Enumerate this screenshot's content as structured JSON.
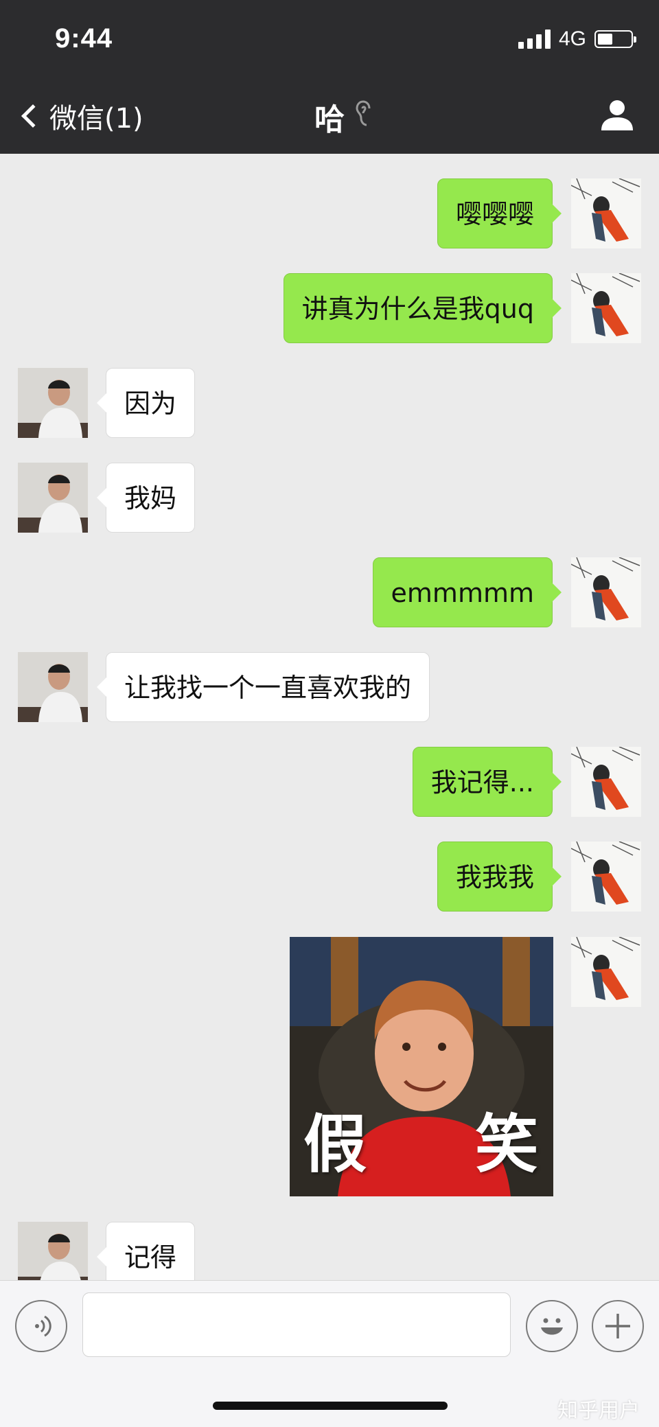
{
  "status_bar": {
    "time": "9:44",
    "network": "4G"
  },
  "nav": {
    "back_label": "微信(1)",
    "title": "哈"
  },
  "messages": [
    {
      "side": "me",
      "text": "嘤嘤嘤"
    },
    {
      "side": "me",
      "text": "讲真为什么是我quq"
    },
    {
      "side": "other",
      "text": "因为"
    },
    {
      "side": "other",
      "text": "我妈"
    },
    {
      "side": "me",
      "text": "emmmmm"
    },
    {
      "side": "other",
      "text": "让我找一个一直喜欢我的"
    },
    {
      "side": "me",
      "text": "我记得..."
    },
    {
      "side": "me",
      "text": "我我我"
    },
    {
      "side": "me",
      "type": "sticker",
      "left": "假",
      "right": "笑"
    },
    {
      "side": "other",
      "text": "记得"
    }
  ],
  "input_bar": {
    "placeholder": ""
  },
  "watermark": "知乎用户"
}
